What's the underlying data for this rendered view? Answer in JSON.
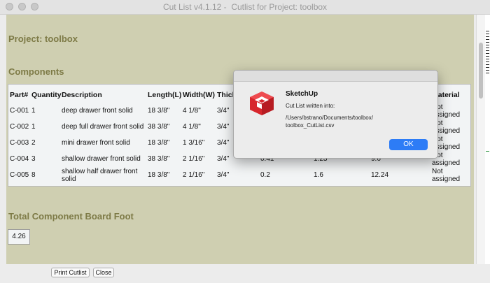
{
  "window": {
    "title": "Cut List v4.1.12 -  Cutlist for Project: toolbox"
  },
  "report": {
    "project_heading": "Project: toolbox",
    "components_heading": "Components",
    "table": {
      "headers": [
        "Part#",
        "Quantity",
        "Description",
        "Length(L)",
        "Width(W)",
        "Thick",
        "",
        "",
        "",
        "Material"
      ],
      "rows": [
        [
          "C-001",
          "1",
          "deep drawer front solid",
          "18 3/8\"",
          "4 1/8\"",
          "3/4\"",
          "",
          "",
          "",
          "Not assigned"
        ],
        [
          "C-002",
          "1",
          "deep full drawer front solid",
          "38 3/8\"",
          "4 1/8\"",
          "3/4\"",
          "",
          "",
          "",
          "Not assigned"
        ],
        [
          "C-003",
          "2",
          "mini drawer front solid",
          "18 3/8\"",
          "1 3/16\"",
          "3/4\"",
          "",
          "",
          "",
          "Not assigned"
        ],
        [
          "C-004",
          "3",
          "shallow drawer front solid",
          "38 3/8\"",
          "2 1/16\"",
          "3/4\"",
          "0.41",
          "1.23",
          "9.6",
          "Not assigned"
        ],
        [
          "C-005",
          "8",
          "shallow half drawer front solid",
          "18 3/8\"",
          "2 1/16\"",
          "3/4\"",
          "0.2",
          "1.6",
          "12.24",
          "Not assigned"
        ]
      ]
    },
    "total_heading": "Total Component Board Foot",
    "total_value": "4.26"
  },
  "buttons": {
    "print": "Print Cutlist",
    "close": "Close"
  },
  "dialog": {
    "title": "SketchUp",
    "message": "Cut List written into:",
    "path_line1": "/Users/bstrano/Documents/toolbox/",
    "path_line2": "toolbox_CutList.csv",
    "ok": "OK"
  },
  "colors": {
    "content_bg": "#cfcfb1",
    "heading": "#7d7a46",
    "ok_button": "#2d7cf6"
  }
}
